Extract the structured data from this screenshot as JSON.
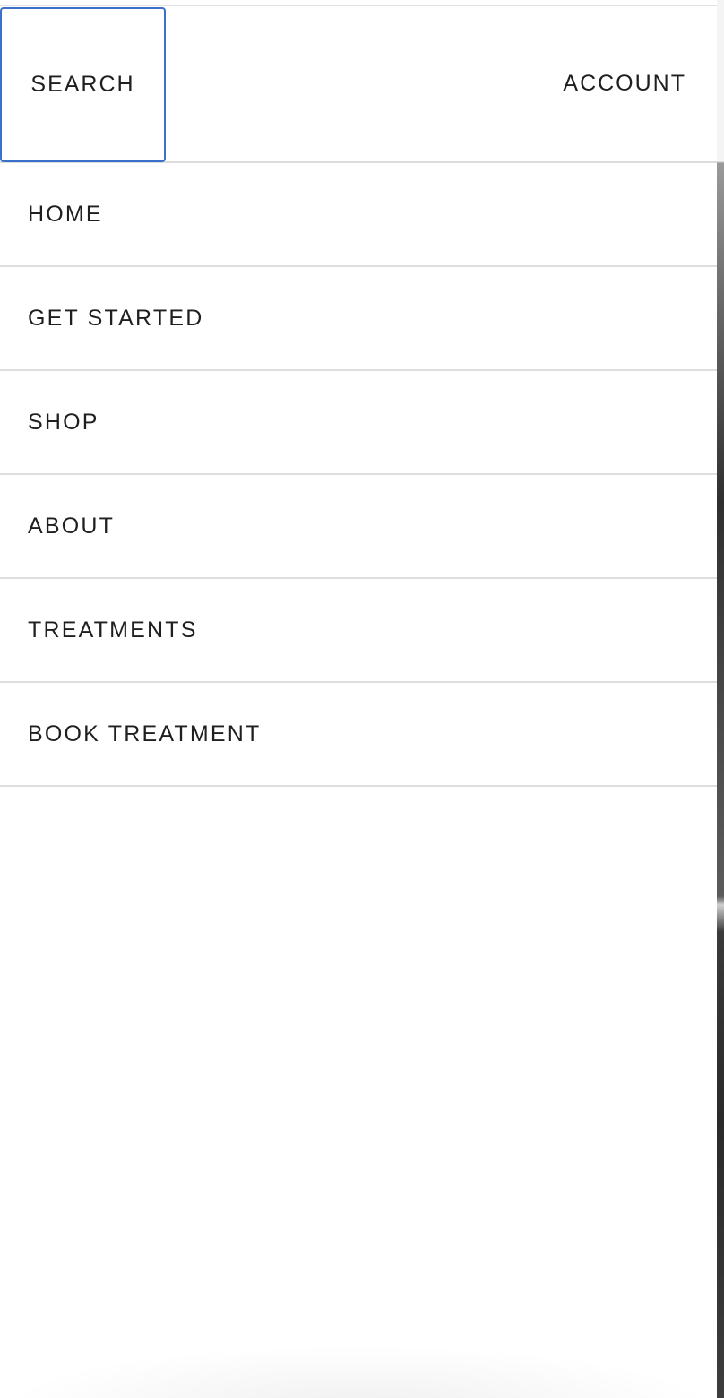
{
  "header": {
    "search_label": "SEARCH",
    "account_label": "ACCOUNT"
  },
  "nav": {
    "items": [
      {
        "label": "HOME"
      },
      {
        "label": "GET STARTED"
      },
      {
        "label": "SHOP"
      },
      {
        "label": "ABOUT"
      },
      {
        "label": "TREATMENTS"
      },
      {
        "label": "BOOK TREATMENT"
      }
    ]
  },
  "colors": {
    "focus_outline": "#3a6fcb",
    "text": "#1f1f1f",
    "divider": "#dedede"
  }
}
